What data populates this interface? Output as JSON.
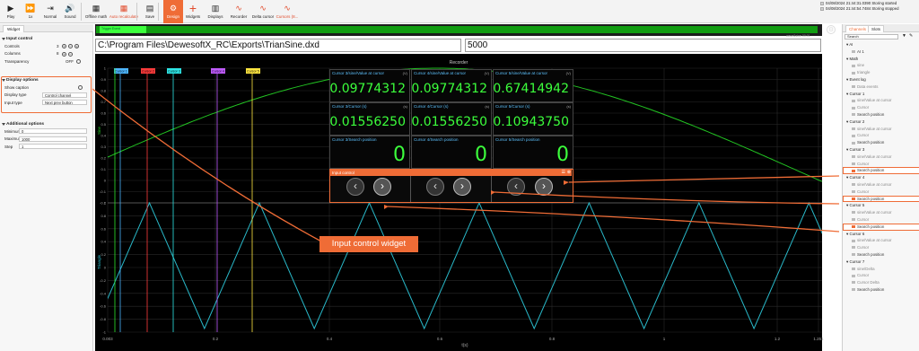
{
  "toolbar": {
    "buttons": [
      {
        "id": "play",
        "label": "Play",
        "icon": "play-icon",
        "glyph": "▶"
      },
      {
        "id": "speed",
        "label": "1x",
        "icon": "fast-forward-icon",
        "glyph": "⏩"
      },
      {
        "id": "normal",
        "label": "Normal",
        "icon": "step-icon",
        "glyph": "⇥"
      },
      {
        "id": "sound",
        "label": "Sound",
        "icon": "sound-icon",
        "glyph": "🔊"
      },
      {
        "id": "offline-math",
        "label": "Offline math",
        "icon": "calculator-icon",
        "glyph": "▦"
      },
      {
        "id": "auto-recalculate",
        "label": "Auto recalculate",
        "icon": "recalculate-icon",
        "glyph": "▦"
      },
      {
        "id": "save",
        "label": "Save",
        "icon": "save-icon",
        "glyph": "▤"
      },
      {
        "id": "design",
        "label": "Design",
        "icon": "gear-icon",
        "glyph": "⚙"
      },
      {
        "id": "widgets",
        "label": "Widgets",
        "icon": "plus-icon",
        "glyph": "+"
      },
      {
        "id": "displays",
        "label": "Displays",
        "icon": "displays-icon",
        "glyph": "▥"
      },
      {
        "id": "recorder",
        "label": "Recorder",
        "icon": "recorder-icon",
        "glyph": "∿"
      },
      {
        "id": "delta-cursor",
        "label": "Delta cursor",
        "icon": "delta-cursor-icon",
        "glyph": "∿"
      },
      {
        "id": "cursors",
        "label": "Cursors (8...",
        "icon": "cursors-icon",
        "glyph": "∿"
      }
    ]
  },
  "status": {
    "lines": [
      "04/08/2024 21:44:31.0390 Storing started",
      "04/08/2024 21:44:54.7484 Storing stopped"
    ]
  },
  "left_panel": {
    "tab": "Widget",
    "input_control": {
      "title": "Input control",
      "controls": "Controls",
      "controls_value": "3",
      "columns": "Columns",
      "columns_value": "8",
      "transparency": "Transparency",
      "transparency_value": "OFF"
    },
    "display_options": {
      "title": "Display options",
      "show_caption": "Show caption",
      "display_type": "Display type",
      "display_type_value": "Control channel",
      "input_type": "Input type",
      "input_type_value": "Next prev button"
    },
    "additional_options": {
      "title": "Additional options",
      "minimum": "Minimum",
      "minimum_value": "0",
      "maximum": "Maximum",
      "maximum_value": "1000",
      "step": "Step",
      "step_value": "1"
    }
  },
  "top_strip": {
    "label_left": "Trigger Event",
    "label_right": "wave&sine  00:01"
  },
  "file_field": "C:\\Program Files\\DewesoftX_RC\\Exports\\TrianSine.dxd",
  "number_field": "5000",
  "recorder": {
    "title": "Recorder",
    "xlabel": "t(s)",
    "ylabel_top": "Sine",
    "ylabel_bottom": "Triangle",
    "x_ticks": [
      "0.003",
      "0.2",
      "0.4",
      "0.6",
      "0.8",
      "1",
      "1.2",
      "1.251"
    ],
    "y_ticks_top": [
      "1",
      "0.9",
      "0.8",
      "0.7",
      "0.6",
      "0.5",
      "0.4",
      "0.3",
      "0.2",
      "0.1",
      "0",
      "-0.1",
      "-0.2"
    ],
    "y_ticks_bottom": [
      "1",
      "0.8",
      "0.6",
      "0.4",
      "0.2",
      "0",
      "-0.2",
      "-0.4",
      "-0.6",
      "-0.8",
      "-1"
    ],
    "cursor_tags": [
      {
        "label": "Cursor 1",
        "color": "#4db6ff"
      },
      {
        "label": "Cursor 2",
        "color": "#ff3b3b"
      },
      {
        "label": "Cursor 3",
        "color": "#2ee6e6"
      },
      {
        "label": "Cursor 4",
        "color": "#c05bff"
      },
      {
        "label": "Cursor 5",
        "color": "#ffe640"
      }
    ]
  },
  "value_cells": [
    {
      "title": "Cursor 3/sine/Value at cursor",
      "unit": "(V)",
      "value": "0.09774312"
    },
    {
      "title": "Cursor 4/sine/Value at cursor",
      "unit": "(V)",
      "value": "0.09774312"
    },
    {
      "title": "Cursor 5/sine/Value at cursor",
      "unit": "(V)",
      "value": "0.67414942"
    },
    {
      "title": "Cursor 3/Cursor (s)",
      "unit": "(s)",
      "value": "0.01556250"
    },
    {
      "title": "Cursor 4/Cursor (s)",
      "unit": "(s)",
      "value": "0.01556250"
    },
    {
      "title": "Cursor 5/Cursor (s)",
      "unit": "(s)",
      "value": "0.10943750"
    },
    {
      "title": "Cursor 3/Search position",
      "unit": "",
      "value": "0"
    },
    {
      "title": "Cursor 4/Search position",
      "unit": "",
      "value": "0"
    },
    {
      "title": "Cursor 5/Search position",
      "unit": "",
      "value": "0"
    }
  ],
  "input_control_widget": {
    "title": "Input control"
  },
  "callout": "Input control widget",
  "right_panel": {
    "tabs": [
      "Channels",
      "Slots"
    ],
    "search_placeholder": "Search",
    "tree": [
      {
        "t": "AI",
        "lvl": 0
      },
      {
        "t": "AI 1",
        "lvl": 1
      },
      {
        "t": "Math",
        "lvl": 0
      },
      {
        "t": "sine",
        "lvl": 1,
        "dim": true
      },
      {
        "t": "triangle",
        "lvl": 1,
        "dim": true
      },
      {
        "t": "Event log",
        "lvl": 0
      },
      {
        "t": "Data events",
        "lvl": 1,
        "dim": true
      },
      {
        "t": "Cursor 1",
        "lvl": 0
      },
      {
        "t": "sine/Value at cursor",
        "lvl": 1,
        "dim": true
      },
      {
        "t": "Cursor",
        "lvl": 1,
        "dim": true
      },
      {
        "t": "Search position",
        "lvl": 1
      },
      {
        "t": "Cursor 2",
        "lvl": 0
      },
      {
        "t": "sine/Value at cursor",
        "lvl": 1,
        "dim": true
      },
      {
        "t": "Cursor",
        "lvl": 1,
        "dim": true
      },
      {
        "t": "Search position",
        "lvl": 1
      },
      {
        "t": "Cursor 3",
        "lvl": 0
      },
      {
        "t": "sine/Value at cursor",
        "lvl": 1,
        "dim": true
      },
      {
        "t": "Cursor",
        "lvl": 1,
        "dim": true
      },
      {
        "t": "Search position",
        "lvl": 1,
        "hi": true
      },
      {
        "t": "Cursor 4",
        "lvl": 0
      },
      {
        "t": "sine/Value at cursor",
        "lvl": 1,
        "dim": true
      },
      {
        "t": "Cursor",
        "lvl": 1,
        "dim": true
      },
      {
        "t": "Search position",
        "lvl": 1,
        "hi": true
      },
      {
        "t": "Cursor 5",
        "lvl": 0
      },
      {
        "t": "sine/Value at cursor",
        "lvl": 1,
        "dim": true
      },
      {
        "t": "Cursor",
        "lvl": 1,
        "dim": true
      },
      {
        "t": "Search position",
        "lvl": 1,
        "hi": true
      },
      {
        "t": "Cursor 6",
        "lvl": 0
      },
      {
        "t": "sine/Value at cursor",
        "lvl": 1,
        "dim": true
      },
      {
        "t": "Cursor",
        "lvl": 1,
        "dim": true
      },
      {
        "t": "Search position",
        "lvl": 1
      },
      {
        "t": "Cursor 7",
        "lvl": 0
      },
      {
        "t": "sine/Delta",
        "lvl": 1,
        "dim": true
      },
      {
        "t": "Cursor",
        "lvl": 1,
        "dim": true
      },
      {
        "t": "Cursor Delta",
        "lvl": 1,
        "dim": true
      },
      {
        "t": "Search position",
        "lvl": 1
      }
    ]
  },
  "colors": {
    "accent": "#ef6c36",
    "sine": "#22c322",
    "triangle": "#29b8c8",
    "value": "#3cff3c"
  }
}
